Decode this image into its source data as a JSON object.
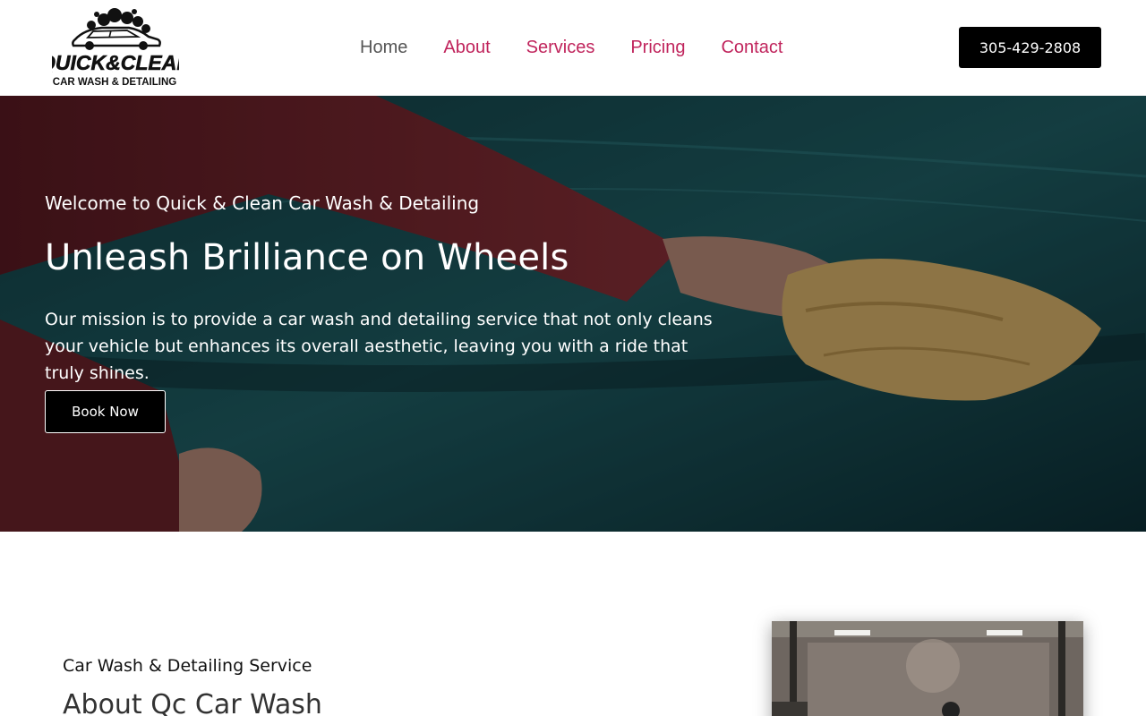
{
  "header": {
    "logo_text_top": "QUICK&CLEAN",
    "logo_text_bottom": "CAR WASH & DETAILING",
    "nav": [
      {
        "label": "Home",
        "active": true
      },
      {
        "label": "About",
        "active": false
      },
      {
        "label": "Services",
        "active": false
      },
      {
        "label": "Pricing",
        "active": false
      },
      {
        "label": "Contact",
        "active": false
      }
    ],
    "phone": "305-429-2808"
  },
  "hero": {
    "kicker": "Welcome to Quick & Clean Car Wash & Detailing",
    "title": "Unleash Brilliance on Wheels",
    "text": "Our mission is to provide a car wash and detailing service that not only cleans your vehicle but enhances its overall aesthetic, leaving you with a ride that truly shines.",
    "button": "Book Now"
  },
  "about": {
    "kicker": "Car Wash & Detailing Service",
    "title": "About Qc Car Wash"
  },
  "colors": {
    "nav_link": "#c0245c",
    "nav_active": "#555555",
    "button_bg": "#000000"
  }
}
